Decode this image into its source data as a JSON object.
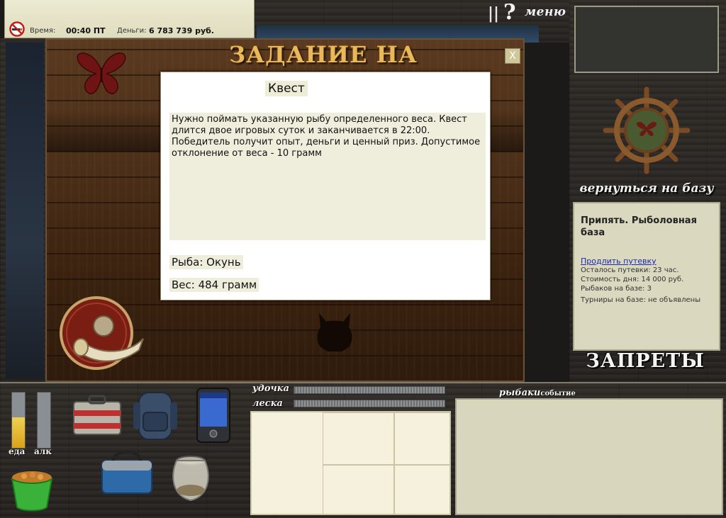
{
  "status_bar": {
    "time_label": "Время:",
    "time_value": "00:40 ПТ",
    "money_label": "Деньги:",
    "money_value": "6 783 739 руб."
  },
  "top_menu": {
    "pause_symbol": "||",
    "help_symbol": "?",
    "menu_label": "меню"
  },
  "quest_window": {
    "title": "ЗАДАНИЕ НА КВЕСТ",
    "close_label": "X",
    "heading": "Квест",
    "description": "Нужно поймать указанную рыбу определенного веса. Квест длится двое игровых суток и заканчивается в 22:00. Победитель получит опыт, деньги и ценный приз. Допустимое отклонение от веса - 10 грамм",
    "fish_line": "Рыба: Окунь",
    "weight_line": "Вес: 484 грамм"
  },
  "right_panel": {
    "return_label": "вернуться на базу",
    "base_name": "Припять. Рыболовная база",
    "extend_link": "Продлить путевку",
    "info_lines": [
      "Осталось путевки: 23 час.",
      "Стоимость дня: 14 000 руб.",
      "Рыбаков на базе: 3",
      "Турниры на базе: не объявлены"
    ],
    "bans_label": "ЗАПРЕТЫ"
  },
  "bottom": {
    "food_label": "еда",
    "alc_label": "алк",
    "food_level": 0.55,
    "alc_level": 0.0,
    "rod_label": "удочка",
    "line_label": "леска",
    "fishers_tab": "рыбаки",
    "event_tab": "событие"
  },
  "colors": {
    "accent_gold": "#e9b85a",
    "panel_cream": "#efeedd",
    "link_blue": "#1a2aa8"
  }
}
